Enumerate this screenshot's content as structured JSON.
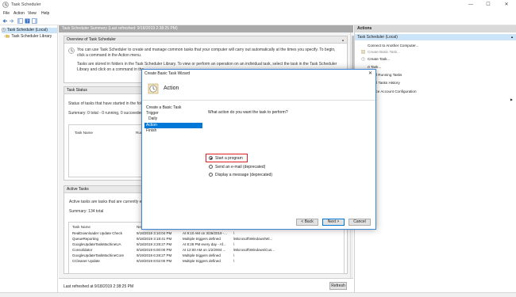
{
  "window": {
    "title": "Task Scheduler",
    "controls": {
      "minimize": "—",
      "maximize": "☐",
      "close": "✕"
    }
  },
  "menu": [
    "File",
    "Action",
    "View",
    "Help"
  ],
  "tree": {
    "items": [
      {
        "label": "Task Scheduler (Local)",
        "selected": true
      },
      {
        "label": "Task Scheduler Library",
        "selected": false
      }
    ]
  },
  "center": {
    "header": "Task Scheduler Summary (Last refreshed: 9/18/2019 2:38:25 PM)",
    "overview": {
      "title": "Overview of Task Scheduler",
      "para1": "You can use Task Scheduler to create and manage common tasks that your computer will carry out automatically at the times you specify. To begin, click a command in the Action menu.",
      "para2": "Tasks are stored in folders in the Task Scheduler Library. To view or perform an operation on an individual task, select the task in the Task Scheduler Library and click on a command in the"
    },
    "status": {
      "title": "Task Status",
      "line1": "Status of tasks that have started in the follo",
      "line2": "Summary: 0 total - 0 running, 0 succeeded, 0",
      "columns": [
        "Task Name",
        "Run R"
      ]
    },
    "active": {
      "title": "Active Tasks",
      "line1": "Active tasks are tasks that are currently enab",
      "summary": "Summary: 134 total",
      "columns": [
        "Task Name",
        "Next Run Time",
        "Triggers",
        "Location"
      ],
      "rows": [
        [
          "RealDownloader Update Check",
          "9/18/2019 3:10:04 PM",
          "At 9:10 AM on 3/26/2019 -...",
          "\\"
        ],
        [
          "QueueReporting",
          "9/18/2019 3:18:41 PM",
          "Multiple triggers defined",
          "\\Microsoft\\Windows\\Wi..."
        ],
        [
          "GoogleUpdateTaskMachineUA",
          "9/18/2019 3:28:27 PM",
          "At 8:28 PM every day - Af...",
          "\\"
        ],
        [
          "Consolidator",
          "9/18/2019 6:00:00 PM",
          "At 12:00 AM on 1/2/2004 ...",
          "\\Microsoft\\Windows\\Cus..."
        ],
        [
          "GoogleUpdateTaskMachineCore",
          "9/19/2019 6:28:27 PM",
          "Multiple triggers defined",
          "\\"
        ],
        [
          "CCleaner Update",
          "9/19/2019 8:02:00 PM",
          "Multiple triggers defined",
          "\\"
        ]
      ]
    },
    "last_refreshed": "Last refreshed at 9/18/2019 2:38:25 PM",
    "refresh_label": "Refresh"
  },
  "actions": {
    "header": "Actions",
    "subheader": "Task Scheduler (Local)",
    "items": [
      {
        "label": "Connect to Another Computer...",
        "icon": "computer-icon",
        "dim": false
      },
      {
        "label": "Create Basic Task...",
        "icon": "create-basic-task-icon",
        "dim": true
      },
      {
        "label": "Create Task...",
        "icon": "create-task-icon",
        "dim": false
      },
      {
        "label": "rt Task...",
        "icon": "",
        "dim": false
      },
      {
        "label": "lay All Running Tasks",
        "icon": "",
        "dim": false
      },
      {
        "label": "ble All Tasks History",
        "icon": "",
        "dim": false
      },
      {
        "label": "Service Account Configuration",
        "icon": "",
        "dim": false
      },
      {
        "label": "",
        "icon": "",
        "dim": false,
        "arrow": true
      },
      {
        "label": "esh",
        "icon": "",
        "dim": false
      },
      {
        "label": "",
        "icon": "",
        "dim": false
      }
    ]
  },
  "dialog": {
    "title": "Create Basic Task Wizard",
    "close": "✕",
    "heading": "Action",
    "steps": [
      {
        "label": "Create a Basic Task",
        "indent": false,
        "active": false
      },
      {
        "label": "Trigger",
        "indent": false,
        "active": false
      },
      {
        "label": "Daily",
        "indent": true,
        "active": false
      },
      {
        "label": "Action",
        "indent": false,
        "active": true
      },
      {
        "label": "Finish",
        "indent": false,
        "active": false
      }
    ],
    "question": "What action do you want the task to perform?",
    "options": [
      {
        "label": "Start a program",
        "checked": true
      },
      {
        "label": "Send an e-mail (deprecated)",
        "checked": false
      },
      {
        "label": "Display a message (deprecated)",
        "checked": false
      }
    ],
    "buttons": {
      "back": "< Back",
      "next": "Next >",
      "cancel": "Cancel"
    }
  },
  "colors": {
    "accent": "#0078d7",
    "highlight": "#e02020",
    "selection": "#cce4f7"
  }
}
